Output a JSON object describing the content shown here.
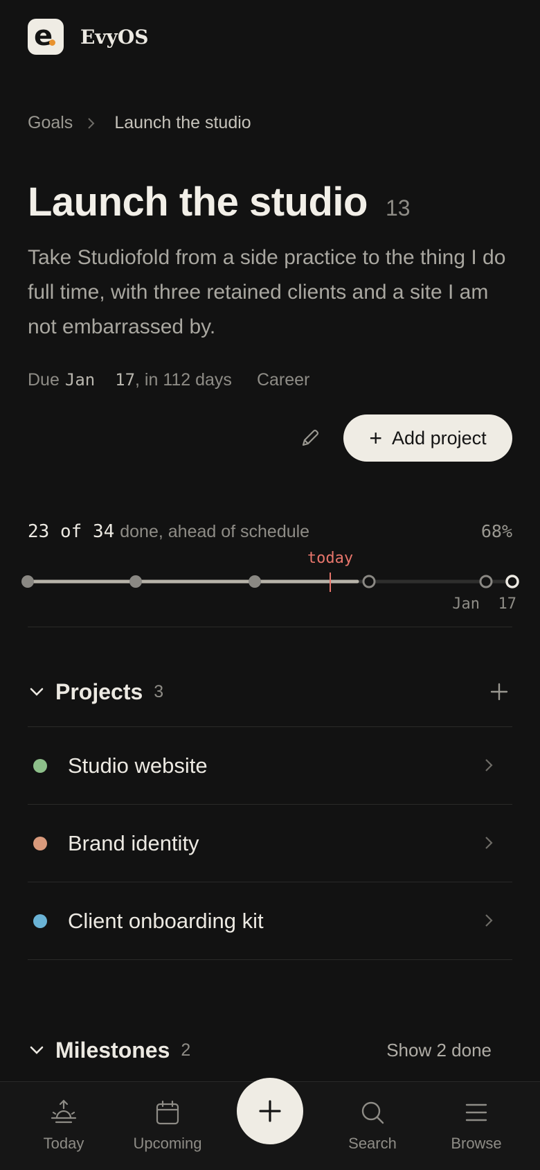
{
  "app": {
    "name": "EvyOS",
    "logo_letter": "e"
  },
  "breadcrumb": {
    "parent": "Goals",
    "current": "Launch the studio"
  },
  "goal": {
    "title": "Launch the studio",
    "count": "13",
    "description": "Take Studiofold from a side practice to the thing I do full time, with three retained clients and a site I am not embarrassed by.",
    "due_prefix": "Due",
    "due_date": "Jan  17",
    "due_suffix": ", in 112 days",
    "category": "Career"
  },
  "actions": {
    "add_project_label": "Add project"
  },
  "progress": {
    "done": "23",
    "of_word": "of",
    "total": "34",
    "status_text": "done, ahead of schedule",
    "percent_label": "68%",
    "fraction": 0.68,
    "today_label": "today",
    "end_label": "Jan  17"
  },
  "projects": {
    "title": "Projects",
    "count": "3",
    "items": [
      {
        "name": "Studio website",
        "color": "#8dbf8a"
      },
      {
        "name": "Brand identity",
        "color": "#d99a7c"
      },
      {
        "name": "Client onboarding kit",
        "color": "#6ab3d6"
      }
    ]
  },
  "milestones": {
    "title": "Milestones",
    "count": "2",
    "show_done_label": "Show 2 done"
  },
  "nav": {
    "items": [
      {
        "label": "Today",
        "icon": "sunrise-icon"
      },
      {
        "label": "Upcoming",
        "icon": "calendar-icon"
      },
      {
        "label": "Search",
        "icon": "search-icon"
      },
      {
        "label": "Browse",
        "icon": "menu-icon"
      }
    ],
    "fab_icon": "plus-icon"
  },
  "colors": {
    "background": "#121212",
    "accent_today": "#e8766c",
    "surface_light": "#efece4"
  }
}
